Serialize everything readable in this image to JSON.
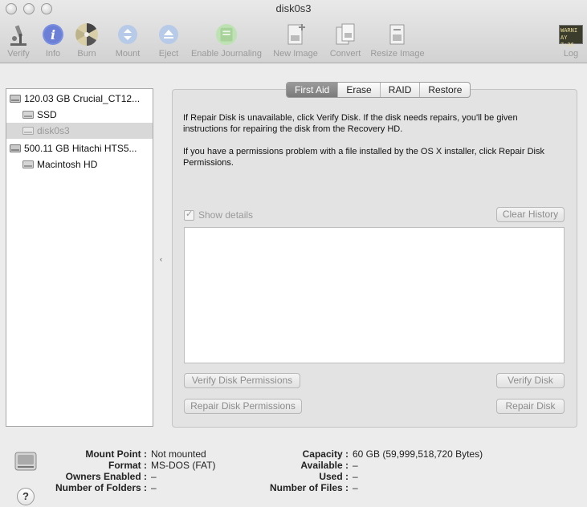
{
  "window": {
    "title": "disk0s3"
  },
  "toolbar": {
    "verify": "Verify",
    "info": "Info",
    "burn": "Burn",
    "mount": "Mount",
    "eject": "Eject",
    "enable_journaling": "Enable Journaling",
    "new_image": "New Image",
    "convert": "Convert",
    "resize_image": "Resize Image",
    "log": "Log",
    "log_icon_text_1": "WARNI",
    "log_icon_text_2": "AY 7:36"
  },
  "sidebar": {
    "items": [
      {
        "label": "120.03 GB Crucial_CT12..."
      },
      {
        "label": "SSD"
      },
      {
        "label": "disk0s3"
      },
      {
        "label": "500.11 GB Hitachi HTS5..."
      },
      {
        "label": "Macintosh HD"
      }
    ]
  },
  "tabs": [
    "First Aid",
    "Erase",
    "RAID",
    "Restore"
  ],
  "first_aid": {
    "para1": "If Repair Disk is unavailable, click Verify Disk. If the disk needs repairs, you'll be given instructions for repairing the disk from the Recovery HD.",
    "para2": "If you have a permissions problem with a file installed by the OS X installer, click Repair Disk Permissions.",
    "show_details": "Show details",
    "clear_history": "Clear History",
    "verify_permissions": "Verify Disk Permissions",
    "verify_disk": "Verify Disk",
    "repair_permissions": "Repair Disk Permissions",
    "repair_disk": "Repair Disk"
  },
  "info": {
    "mount_point_label": "Mount Point :",
    "mount_point": "Not mounted",
    "format_label": "Format :",
    "format": "MS-DOS (FAT)",
    "owners_label": "Owners Enabled :",
    "owners": "–",
    "folders_label": "Number of Folders :",
    "folders": "–",
    "capacity_label": "Capacity :",
    "capacity": "60 GB (59,999,518,720 Bytes)",
    "available_label": "Available :",
    "available": "–",
    "used_label": "Used :",
    "used": "–",
    "files_label": "Number of Files :",
    "files": "–",
    "help": "?"
  }
}
